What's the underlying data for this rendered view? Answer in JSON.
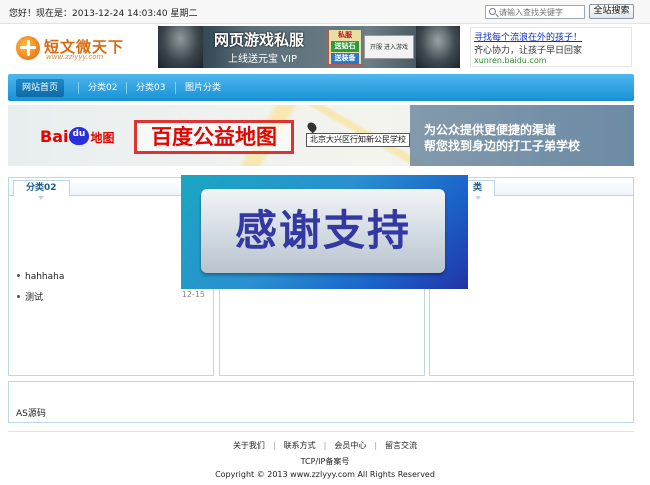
{
  "topbar": {
    "greeting": "您好！现在是：2013-12-24 14:03:40 星期二",
    "search_placeholder": "请输入查找关键字",
    "search_button": "全站搜索"
  },
  "header": {
    "logo_title": "短文微天下",
    "logo_url": "www.zzlyyy.com",
    "game_ad": {
      "title": "网页游戏私服",
      "subtitle": "上线送元宝 VIP",
      "badge_top": "私服",
      "badge_mid": "送钻石",
      "badge_bot": "送装备",
      "panel_text": "开服 进入游戏"
    },
    "text_ad": {
      "link": "寻找每个流浪在外的孩子！",
      "desc": "齐心协力，让孩子早日回家",
      "url": "xunren.baidu.com"
    }
  },
  "nav": {
    "items": [
      {
        "label": "网站首页",
        "active": true
      },
      {
        "label": "分类02",
        "active": false
      },
      {
        "label": "分类03",
        "active": false
      },
      {
        "label": "图片分类",
        "active": false
      }
    ]
  },
  "map_banner": {
    "baidu_left": "Bai",
    "baidu_paw": "du",
    "baidu_right": "地图",
    "title": "百度公益地图",
    "school": "北京大兴区行知新公民学校",
    "slogan1": "为公众提供更便捷的渠道",
    "slogan2": "帮您找到身边的打工子弟学校"
  },
  "boxes": {
    "box1": {
      "title": "分类02",
      "items": [
        {
          "text": "hahhaha",
          "date": ""
        },
        {
          "text": "测试",
          "date": "12-15"
        }
      ]
    },
    "box3": {
      "title_visible": "类"
    }
  },
  "overlay": {
    "text": "感谢支持"
  },
  "bottom": {
    "as_link": "AS源码"
  },
  "footer": {
    "links": [
      "关于我们",
      "联系方式",
      "会员中心",
      "留言交流"
    ],
    "icp": "TCP/IP备案号",
    "copyright": "Copyright © 2013 www.zzlyyy.com All Rights Reserved"
  }
}
